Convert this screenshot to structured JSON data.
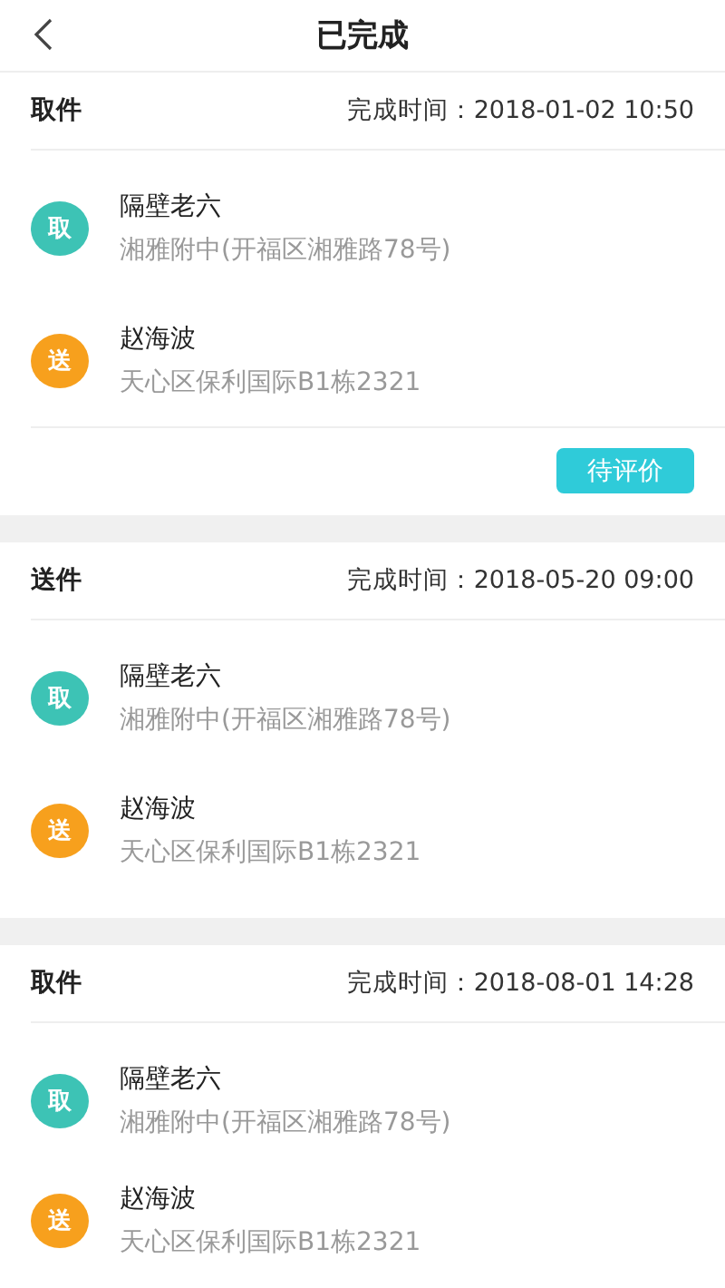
{
  "header": {
    "title": "已完成"
  },
  "orders": [
    {
      "type": "取件",
      "completed": "完成时间：2018-01-02 10:50",
      "stops": [
        {
          "badge": "取",
          "color": "#3dc3b5",
          "name": "隔壁老六",
          "address": "湘雅附中(开福区湘雅路78号)"
        },
        {
          "badge": "送",
          "color": "#f7a01d",
          "name": "赵海波",
          "address": "天心区保利国际B1栋2321"
        }
      ],
      "action": "待评价"
    },
    {
      "type": "送件",
      "completed": "完成时间：2018-05-20 09:00",
      "stops": [
        {
          "badge": "取",
          "color": "#3dc3b5",
          "name": "隔壁老六",
          "address": "湘雅附中(开福区湘雅路78号)"
        },
        {
          "badge": "送",
          "color": "#f7a01d",
          "name": "赵海波",
          "address": "天心区保利国际B1栋2321"
        }
      ]
    },
    {
      "type": "取件",
      "completed": "完成时间：2018-08-01 14:28",
      "stops": [
        {
          "badge": "取",
          "color": "#3dc3b5",
          "name": "隔壁老六",
          "address": "湘雅附中(开福区湘雅路78号)"
        },
        {
          "badge": "送",
          "color": "#f7a01d",
          "name": "赵海波",
          "address": "天心区保利国际B1栋2321"
        }
      ]
    }
  ]
}
